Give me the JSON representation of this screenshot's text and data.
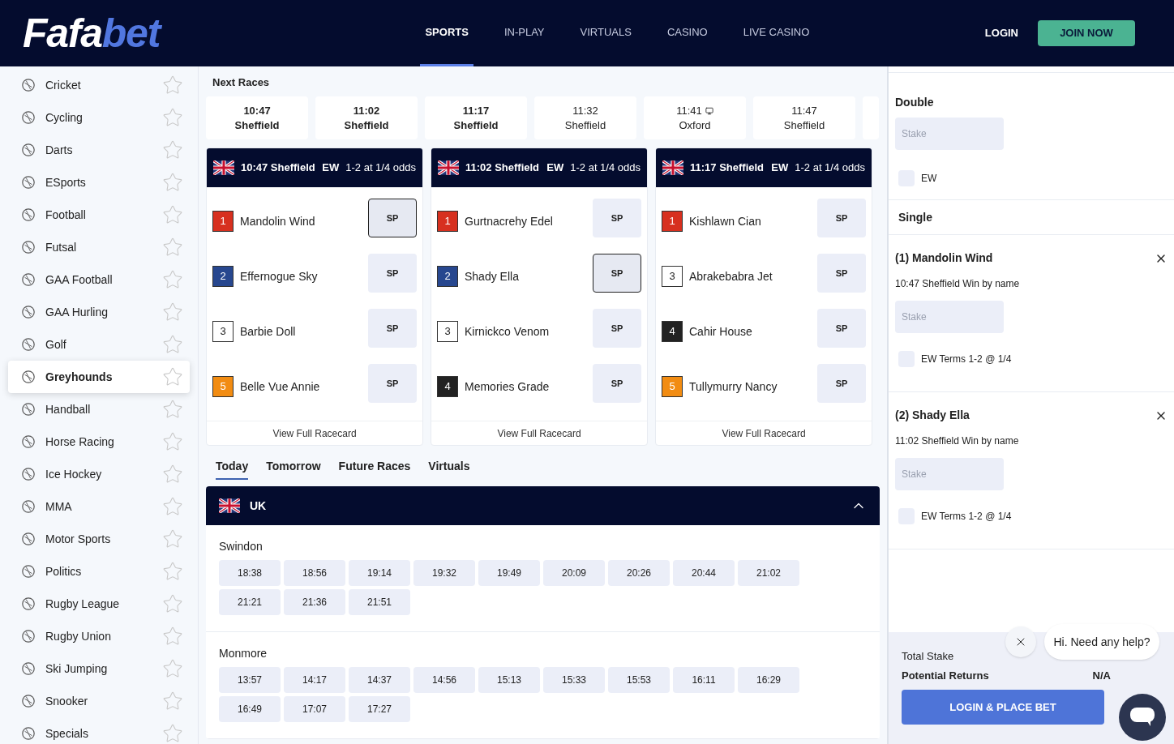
{
  "logo": {
    "text": "Fafa",
    "accent": "bet"
  },
  "nav": [
    {
      "label": "SPORTS",
      "selected": true
    },
    {
      "label": "IN-PLAY",
      "selected": false
    },
    {
      "label": "VIRTUALS",
      "selected": false
    },
    {
      "label": "CASINO",
      "selected": false
    },
    {
      "label": "LIVE CASINO",
      "selected": false
    }
  ],
  "header_actions": {
    "login": "LOGIN",
    "join": "JOIN NOW"
  },
  "sidebar": {
    "items": [
      {
        "label": "Cricket",
        "selected": false,
        "favorite": false
      },
      {
        "label": "Cycling",
        "selected": false,
        "favorite": false
      },
      {
        "label": "Darts",
        "selected": false,
        "favorite": false
      },
      {
        "label": "ESports",
        "selected": false,
        "favorite": false
      },
      {
        "label": "Football",
        "selected": false,
        "favorite": false
      },
      {
        "label": "Futsal",
        "selected": false,
        "favorite": false
      },
      {
        "label": "GAA Football",
        "selected": false,
        "favorite": false
      },
      {
        "label": "GAA Hurling",
        "selected": false,
        "favorite": false
      },
      {
        "label": "Golf",
        "selected": false,
        "favorite": false
      },
      {
        "label": "Greyhounds",
        "selected": true,
        "favorite": false
      },
      {
        "label": "Handball",
        "selected": false,
        "favorite": false
      },
      {
        "label": "Horse Racing",
        "selected": false,
        "favorite": false
      },
      {
        "label": "Ice Hockey",
        "selected": false,
        "favorite": false
      },
      {
        "label": "MMA",
        "selected": false,
        "favorite": false
      },
      {
        "label": "Motor Sports",
        "selected": false,
        "favorite": false
      },
      {
        "label": "Politics",
        "selected": false,
        "favorite": false
      },
      {
        "label": "Rugby League",
        "selected": false,
        "favorite": false
      },
      {
        "label": "Rugby Union",
        "selected": false,
        "favorite": false
      },
      {
        "label": "Ski Jumping",
        "selected": false,
        "favorite": false
      },
      {
        "label": "Snooker",
        "selected": false,
        "favorite": false
      },
      {
        "label": "Specials",
        "selected": false,
        "favorite": false
      }
    ]
  },
  "next_races": {
    "title": "Next Races",
    "races": [
      {
        "time": "10:47",
        "venue": "Sheffield",
        "highlighted": true,
        "stream": false
      },
      {
        "time": "11:02",
        "venue": "Sheffield",
        "highlighted": true,
        "stream": false
      },
      {
        "time": "11:17",
        "venue": "Sheffield",
        "highlighted": true,
        "stream": false
      },
      {
        "time": "11:32",
        "venue": "Sheffield",
        "highlighted": false,
        "stream": false
      },
      {
        "time": "11:41",
        "venue": "Oxford",
        "highlighted": false,
        "stream": true
      },
      {
        "time": "11:47",
        "venue": "Sheffield",
        "highlighted": false,
        "stream": false
      }
    ]
  },
  "race_cards": [
    {
      "title": "10:47 Sheffield",
      "ew": "EW",
      "terms": "1-2 at 1/4 odds",
      "footer": "View Full Racecard",
      "runners": [
        {
          "trap": "1",
          "color": "#d7301f",
          "name": "Mandolin Wind",
          "price": "SP",
          "selected": true
        },
        {
          "trap": "2",
          "color": "#27478f",
          "name": "Effernogue Sky",
          "price": "SP",
          "selected": false
        },
        {
          "trap": "3",
          "color": "#ffffff",
          "name": "Barbie Doll",
          "price": "SP",
          "selected": false
        },
        {
          "trap": "5",
          "color": "#f28c12",
          "name": "Belle Vue Annie",
          "price": "SP",
          "selected": false
        }
      ]
    },
    {
      "title": "11:02 Sheffield",
      "ew": "EW",
      "terms": "1-2 at 1/4 odds",
      "footer": "View Full Racecard",
      "runners": [
        {
          "trap": "1",
          "color": "#d7301f",
          "name": "Gurtnacrehy Edel",
          "price": "SP",
          "selected": false
        },
        {
          "trap": "2",
          "color": "#27478f",
          "name": "Shady Ella",
          "price": "SP",
          "selected": true
        },
        {
          "trap": "3",
          "color": "#ffffff",
          "name": "Kirnickco Venom",
          "price": "SP",
          "selected": false
        },
        {
          "trap": "4",
          "color": "#222222",
          "name": "Memories Grade",
          "price": "SP",
          "selected": false
        }
      ]
    },
    {
      "title": "11:17 Sheffield",
      "ew": "EW",
      "terms": "1-2 at 1/4 odds",
      "footer": "View Full Racecard",
      "runners": [
        {
          "trap": "1",
          "color": "#d7301f",
          "name": "Kishlawn Cian",
          "price": "SP",
          "selected": false
        },
        {
          "trap": "3",
          "color": "#ffffff",
          "name": "Abrakebabra Jet",
          "price": "SP",
          "selected": false
        },
        {
          "trap": "4",
          "color": "#222222",
          "name": "Cahir House",
          "price": "SP",
          "selected": false
        },
        {
          "trap": "5",
          "color": "#f28c12",
          "name": "Tullymurry Nancy",
          "price": "SP",
          "selected": false
        }
      ]
    }
  ],
  "day_tabs": [
    {
      "label": "Today",
      "selected": true
    },
    {
      "label": "Tomorrow",
      "selected": false
    },
    {
      "label": "Future Races",
      "selected": false
    },
    {
      "label": "Virtuals",
      "selected": false
    }
  ],
  "region": {
    "name": "UK",
    "expanded": true,
    "meetings": [
      {
        "name": "Swindon",
        "times": [
          "18:38",
          "18:56",
          "19:14",
          "19:32",
          "19:49",
          "20:09",
          "20:26",
          "20:44",
          "21:02",
          "21:21",
          "21:36",
          "21:51"
        ]
      },
      {
        "name": "Monmore",
        "times": [
          "13:57",
          "14:17",
          "14:37",
          "14:56",
          "15:13",
          "15:33",
          "15:53",
          "16:11",
          "16:29",
          "16:49",
          "17:07",
          "17:27"
        ]
      }
    ]
  },
  "betslip": {
    "double": {
      "title": "Double",
      "placeholder": "Stake",
      "ew_label": "EW",
      "ew_checked": false
    },
    "single_title": "Single",
    "bets": [
      {
        "title": "(1) Mandolin Wind",
        "detail": "10:47 Sheffield Win by name",
        "placeholder": "Stake",
        "ew_label": "EW Terms 1-2 @ 1/4",
        "ew_checked": false
      },
      {
        "title": "(2) Shady Ella",
        "detail": "11:02 Sheffield Win by name",
        "placeholder": "Stake",
        "ew_label": "EW Terms 1-2 @ 1/4",
        "ew_checked": false
      }
    ],
    "total_stake_label": "Total Stake",
    "returns_label": "Potential Returns",
    "returns_value": "N/A",
    "place_bet": "LOGIN & PLACE BET"
  },
  "chat": {
    "message": "Hi. Need any help?"
  }
}
